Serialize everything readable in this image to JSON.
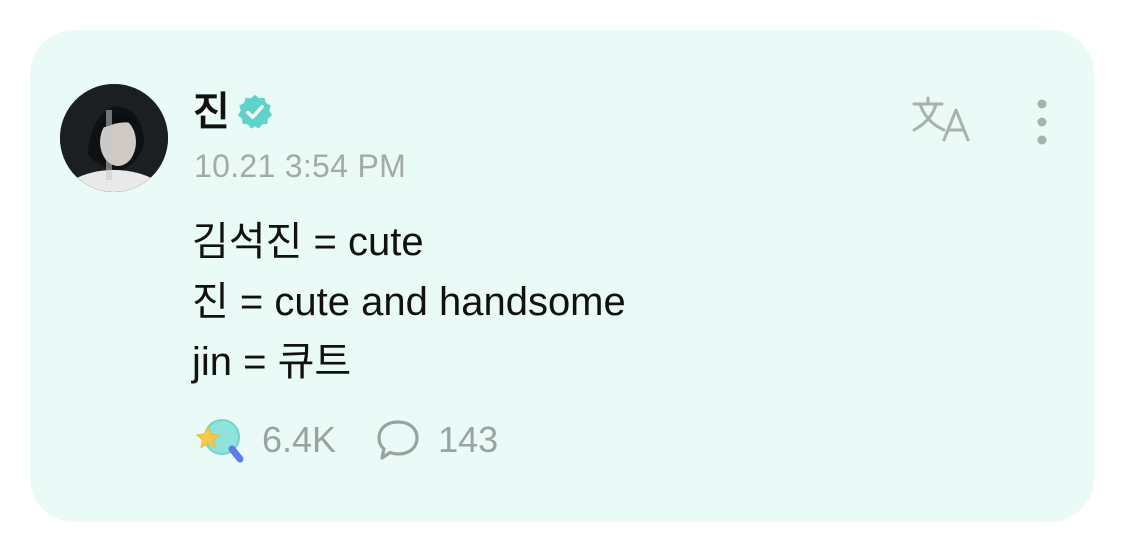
{
  "post": {
    "author": {
      "name": "진",
      "verified": true,
      "avatar_icon": "profile-photo"
    },
    "timestamp": "10.21 3:54 PM",
    "body_lines": [
      "김석진 = cute",
      "진 = cute and handsome",
      "jin = 큐트"
    ],
    "stats": {
      "likes": "6.4K",
      "comments": "143"
    },
    "actions": {
      "translate_icon": "translate-icon",
      "more_icon": "more-vertical-icon"
    }
  },
  "colors": {
    "card_background": "#eafaf7",
    "verified_badge": "#5fd3c9",
    "meta_text": "#a3aaa8",
    "icon_gray": "#9aa3a1"
  }
}
